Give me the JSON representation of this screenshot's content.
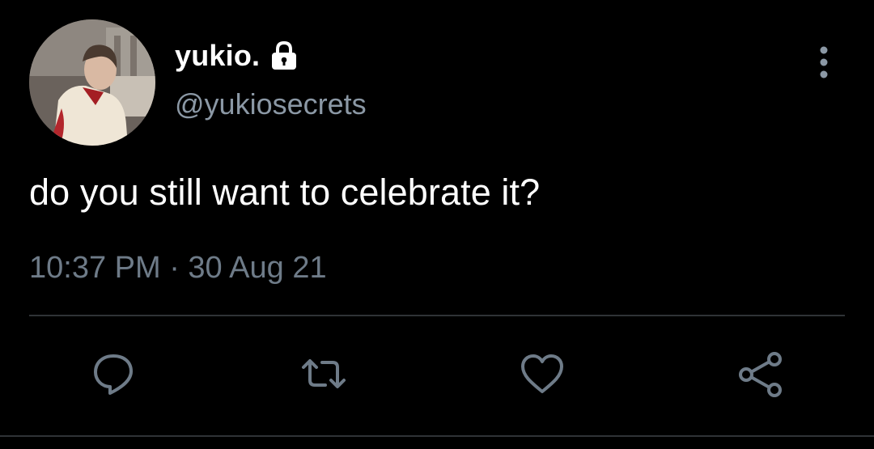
{
  "author": {
    "display_name": "yukio.",
    "handle": "@yukiosecrets",
    "avatar": "avatar-photo",
    "protected_icon": "lock-icon"
  },
  "tweet": {
    "text": "do you still want to celebrate it?",
    "meta": "10:37 PM · 30 Aug 21"
  },
  "actions": {
    "reply_icon": "reply-icon",
    "retweet_icon": "retweet-icon",
    "like_icon": "heart-icon",
    "share_icon": "share-icon",
    "more_icon": "more-vertical-icon"
  },
  "colors": {
    "background": "#000000",
    "text": "#ffffff",
    "secondary": "#8b98a5",
    "icon": "#6e7b88",
    "divider": "#2f3336"
  }
}
